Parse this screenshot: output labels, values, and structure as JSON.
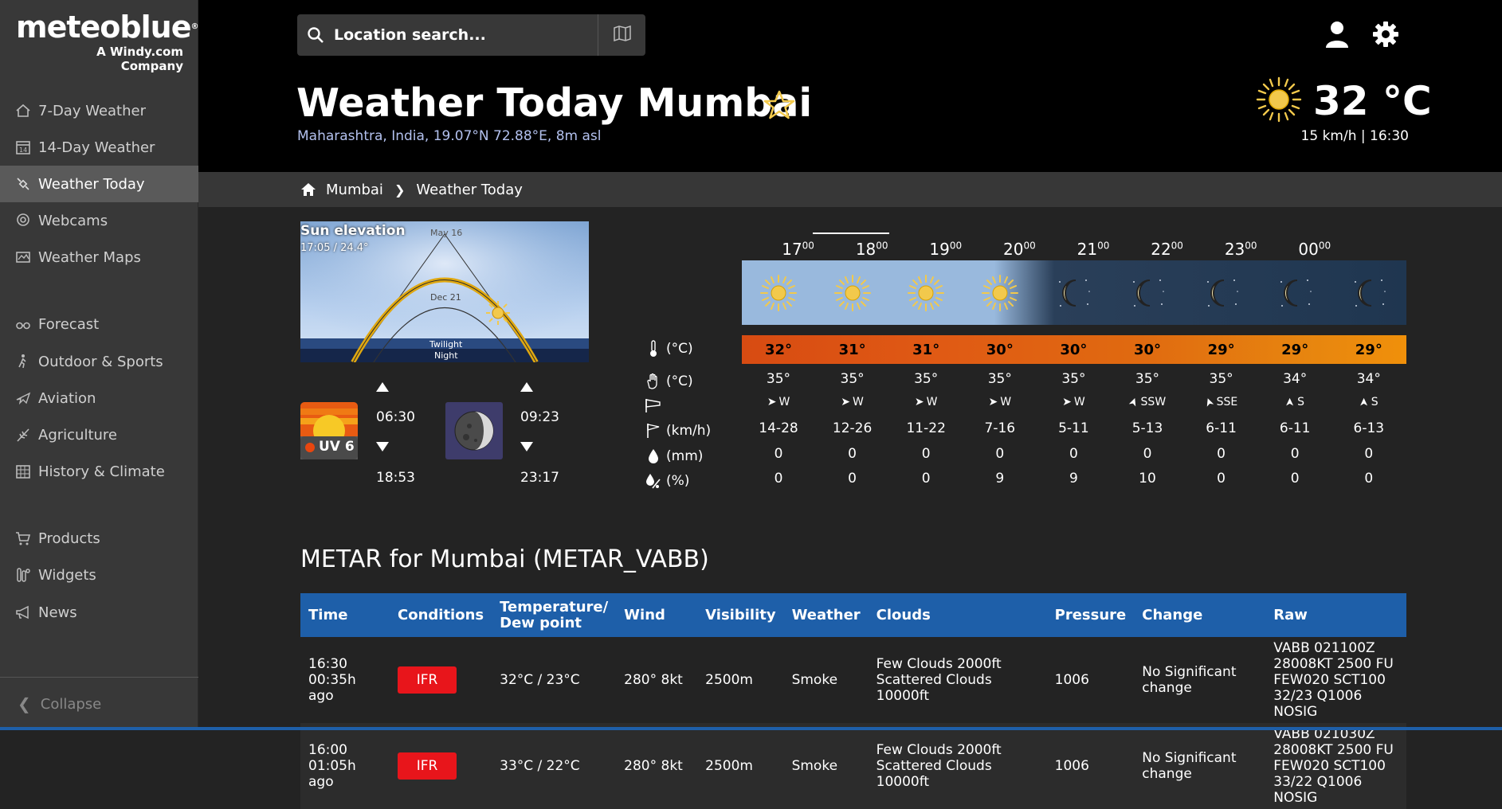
{
  "logo": {
    "brand": "meteoblue",
    "registered": "®",
    "sub": "A Windy.com Company"
  },
  "sidebar": {
    "items": [
      {
        "label": "7-Day Weather",
        "icon": "home-icon"
      },
      {
        "label": "14-Day Weather",
        "icon": "calendar-icon"
      },
      {
        "label": "Weather Today",
        "icon": "satellite-icon"
      },
      {
        "label": "Webcams",
        "icon": "webcam-icon"
      },
      {
        "label": "Weather Maps",
        "icon": "map-icon"
      },
      {
        "label": "Forecast",
        "icon": "binoculars-icon"
      },
      {
        "label": "Outdoor & Sports",
        "icon": "hiker-icon"
      },
      {
        "label": "Aviation",
        "icon": "plane-icon"
      },
      {
        "label": "Agriculture",
        "icon": "plant-icon"
      },
      {
        "label": "History & Climate",
        "icon": "table-icon"
      },
      {
        "label": "Products",
        "icon": "cart-icon"
      },
      {
        "label": "Widgets",
        "icon": "widgets-icon"
      },
      {
        "label": "News",
        "icon": "megaphone-icon"
      }
    ],
    "collapse": "Collapse"
  },
  "header": {
    "search_placeholder": "Location search...",
    "title": "Weather Today Mumbai",
    "subtitle": "Maharashtra, India, 19.07°N 72.88°E, 8m asl",
    "current_temp": "32 °C",
    "current_meta": "15 km/h  | 16:30"
  },
  "breadcrumb": {
    "home": "Mumbai",
    "current": "Weather Today"
  },
  "sun_elevation": {
    "title": "Sun elevation",
    "value": "17:05 / 24.4°",
    "label_max": "May 16",
    "label_min": "Dec 21",
    "label_twilight": "Twilight",
    "label_night": "Night"
  },
  "sun": {
    "uv": "UV 6",
    "rise": "06:30",
    "set": "18:53"
  },
  "moon": {
    "rise": "09:23",
    "set": "23:17"
  },
  "forecast": {
    "hours": [
      "17",
      "18",
      "19",
      "20",
      "21",
      "22",
      "23",
      "00"
    ],
    "hour_suffix": "00",
    "row_labels": {
      "temp": "(°C)",
      "felt": "(°C)",
      "wind_speed": "(km/h)",
      "precip": "(mm)",
      "precip_prob": "(%)"
    },
    "sky": [
      "sun",
      "sun",
      "sun",
      "sun",
      "moon",
      "moon",
      "moon",
      "moon",
      "moon"
    ],
    "temps": [
      "32°",
      "31°",
      "31°",
      "30°",
      "30°",
      "30°",
      "29°",
      "29°",
      "29°"
    ],
    "felt": [
      "35°",
      "35°",
      "35°",
      "35°",
      "35°",
      "35°",
      "35°",
      "34°",
      "34°"
    ],
    "wind_dir": [
      "W",
      "W",
      "W",
      "W",
      "W",
      "SSW",
      "SSE",
      "S",
      "S"
    ],
    "wind_speed": [
      "14-28",
      "12-26",
      "11-22",
      "7-16",
      "5-11",
      "5-13",
      "6-11",
      "6-11",
      "6-13"
    ],
    "precip": [
      "0",
      "0",
      "0",
      "0",
      "0",
      "0",
      "0",
      "0",
      "0"
    ],
    "precip_prob": [
      "0",
      "0",
      "0",
      "9",
      "9",
      "10",
      "0",
      "0",
      "0"
    ]
  },
  "metar": {
    "title": "METAR for Mumbai (METAR_VABB)",
    "headers": [
      "Time",
      "Conditions",
      "Temperature/ Dew point",
      "Wind",
      "Visibility",
      "Weather",
      "Clouds",
      "Pressure",
      "Change",
      "Raw"
    ],
    "rows": [
      {
        "time": "16:30",
        "ago": "00:35h ago",
        "cond": "IFR",
        "temp": "32°C / 23°C",
        "wind": "280° 8kt",
        "vis": "2500m",
        "weather": "Smoke",
        "clouds": [
          "Few Clouds 2000ft",
          "Scattered Clouds",
          "10000ft"
        ],
        "pressure": "1006",
        "change": [
          "No Significant",
          "change"
        ],
        "raw": [
          "VABB 021100Z 28008KT 2500 FU",
          "FEW020 SCT100 32/23 Q1006",
          "NOSIG"
        ]
      },
      {
        "time": "16:00",
        "ago": "01:05h ago",
        "cond": "IFR",
        "temp": "33°C / 22°C",
        "wind": "280° 8kt",
        "vis": "2500m",
        "weather": "Smoke",
        "clouds": [
          "Few Clouds 2000ft",
          "Scattered Clouds",
          "10000ft"
        ],
        "pressure": "1006",
        "change": [
          "No Significant",
          "change"
        ],
        "raw": [
          "VABB 021030Z 28008KT 2500 FU",
          "FEW020 SCT100 33/22 Q1006",
          "NOSIG"
        ]
      }
    ]
  },
  "colors": {
    "accent": "#1e5fa9",
    "ifr": "#e8151b",
    "star": "#f2c94c",
    "sun": "#f2c94c"
  }
}
